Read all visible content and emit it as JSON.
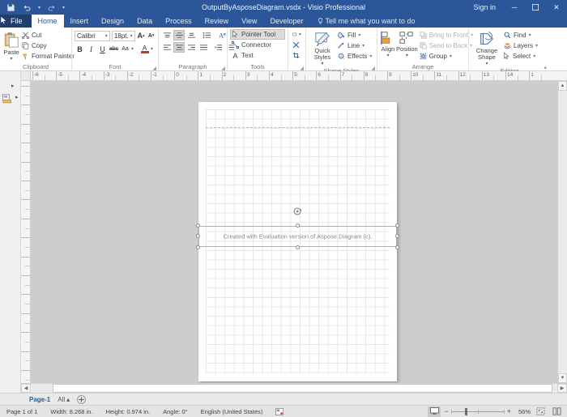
{
  "window": {
    "title": "OutputByAsposeDiagram.vsdx - Visio Professional",
    "signin": "Sign in",
    "minimize": "─",
    "restore": "❐",
    "close": "✕"
  },
  "quick_access": {
    "save": "save-icon",
    "undo": "undo-icon",
    "redo": "redo-icon",
    "customize": "▾"
  },
  "tabs": [
    {
      "label": "File",
      "active": false
    },
    {
      "label": "Home",
      "active": true
    },
    {
      "label": "Insert",
      "active": false
    },
    {
      "label": "Design",
      "active": false
    },
    {
      "label": "Data",
      "active": false
    },
    {
      "label": "Process",
      "active": false
    },
    {
      "label": "Review",
      "active": false
    },
    {
      "label": "View",
      "active": false
    },
    {
      "label": "Developer",
      "active": false
    }
  ],
  "tell_me": "Tell me what you want to do",
  "ribbon": {
    "clipboard": {
      "label": "Clipboard",
      "paste": "Paste",
      "cut": "Cut",
      "copy": "Copy",
      "format_painter": "Format Painter"
    },
    "font": {
      "label": "Font",
      "font_name": "Calibri",
      "font_size": "18pt.",
      "grow": "A",
      "shrink": "A",
      "bold": "B",
      "italic": "I",
      "underline": "U",
      "strikethrough": "abc",
      "change_case": "Aa",
      "font_color": "A"
    },
    "paragraph": {
      "label": "Paragraph"
    },
    "tools": {
      "label": "Tools",
      "pointer_tool": "Pointer Tool",
      "connector": "Connector",
      "text": "Text"
    },
    "shape_styles": {
      "label": "Shape Styles",
      "quick_styles": "Quick Styles",
      "fill": "Fill",
      "line": "Line",
      "effects": "Effects"
    },
    "arrange": {
      "label": "Arrange",
      "align": "Align",
      "position": "Position",
      "bring_to_front": "Bring to Front",
      "send_to_back": "Send to Back",
      "group": "Group"
    },
    "editing": {
      "label": "Editing",
      "change_shape": "Change Shape",
      "find": "Find",
      "layers": "Layers",
      "select": "Select"
    }
  },
  "rulers": {
    "horizontal": [
      "-6",
      "-5",
      "-4",
      "-3",
      "-2",
      "-1",
      "0",
      "1",
      "2",
      "3",
      "4",
      "5",
      "6",
      "7",
      "8",
      "9",
      "10",
      "11",
      "12",
      "13",
      "14",
      "1"
    ]
  },
  "canvas": {
    "shape_text": "Created with Evaluation version of Aspose.Diagram (c).",
    "rotation_handle": "rotation-handle-icon"
  },
  "page_tabs": {
    "page": "Page-1",
    "all": "All",
    "all_caret": "▴",
    "add": "⊕"
  },
  "status": {
    "page": "Page 1 of 1",
    "width": "Width: 8.268 in.",
    "height": "Height: 0.974 in.",
    "angle": "Angle: 0°",
    "language": "English (United States)",
    "zoom_out": "−",
    "zoom_in": "+",
    "zoom_level": "56%"
  },
  "colors": {
    "brand": "#2b579a",
    "file_tab": "#1f3f6e",
    "canvas": "#cdcdcd",
    "accent_orange": "#e8a33d",
    "accent_red": "#c0392b"
  }
}
